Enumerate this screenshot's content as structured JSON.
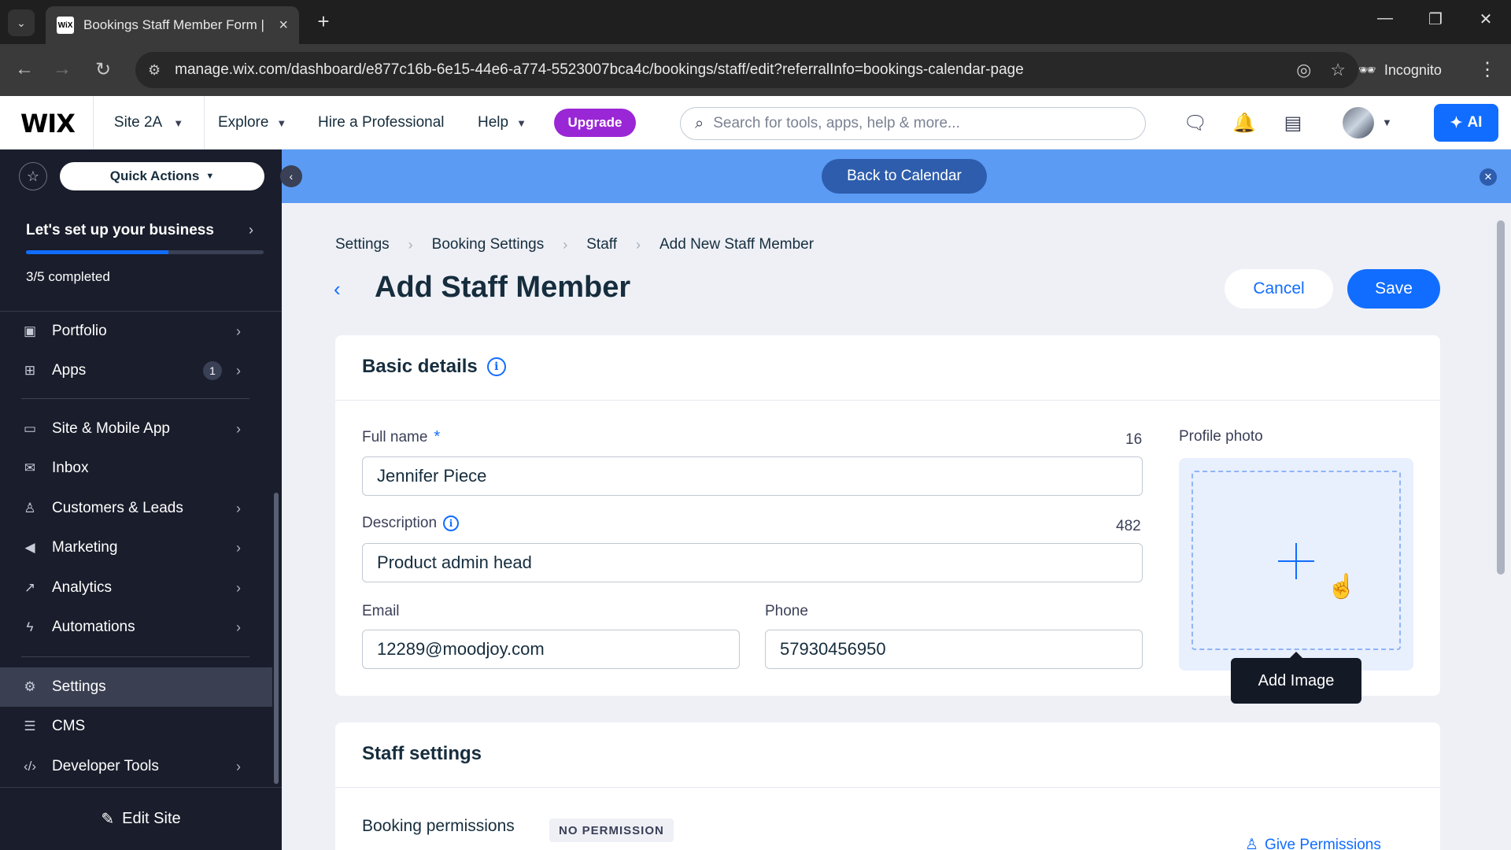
{
  "browser": {
    "tab_title": "Bookings Staff Member Form |",
    "favicon_text": "WiX",
    "url": "manage.wix.com/dashboard/e877c16b-6e15-44e6-a774-5523007bca4c/bookings/staff/edit?referralInfo=bookings-calendar-page",
    "incognito_label": "Incognito"
  },
  "wix_bar": {
    "logo": "WIX",
    "site_name": "Site 2A",
    "nav": [
      {
        "label": "Explore"
      },
      {
        "label": "Hire a Professional"
      },
      {
        "label": "Help"
      }
    ],
    "upgrade_label": "Upgrade",
    "search_placeholder": "Search for tools, apps, help & more...",
    "ai_label": "AI"
  },
  "sidebar": {
    "quick_actions": "Quick Actions",
    "setup_title": "Let's set up your business",
    "setup_progress": 0.6,
    "setup_count": "3/5 completed",
    "items": [
      {
        "label": "Portfolio",
        "icon": "portfolio-icon"
      },
      {
        "label": "Apps",
        "icon": "apps-icon",
        "badge": "1"
      },
      {
        "label": "Site & Mobile App",
        "icon": "site-mobile-icon"
      },
      {
        "label": "Inbox",
        "icon": "inbox-icon"
      },
      {
        "label": "Customers & Leads",
        "icon": "customers-icon"
      },
      {
        "label": "Marketing",
        "icon": "marketing-icon"
      },
      {
        "label": "Analytics",
        "icon": "analytics-icon"
      },
      {
        "label": "Automations",
        "icon": "automations-icon"
      },
      {
        "label": "Settings",
        "icon": "gear-icon"
      },
      {
        "label": "CMS",
        "icon": "cms-icon"
      },
      {
        "label": "Developer Tools",
        "icon": "code-icon"
      }
    ],
    "edit_site": "Edit Site"
  },
  "banner": {
    "back_to_calendar": "Back to Calendar"
  },
  "main": {
    "breadcrumb": [
      "Settings",
      "Booking Settings",
      "Staff",
      "Add New Staff Member"
    ],
    "title": "Add Staff Member",
    "cancel_label": "Cancel",
    "save_label": "Save",
    "basic_details": {
      "title": "Basic details",
      "full_name_label": "Full name",
      "full_name_required": "*",
      "full_name_counter": "16",
      "full_name_value": "Jennifer Piece",
      "description_label": "Description",
      "description_counter": "482",
      "description_value": "Product admin head",
      "email_label": "Email",
      "email_value": "12289@moodjoy.com",
      "phone_label": "Phone",
      "phone_value": "57930456950",
      "profile_photo_label": "Profile photo",
      "add_image_tooltip": "Add Image"
    },
    "staff_settings": {
      "title": "Staff settings",
      "booking_permissions_label": "Booking permissions",
      "permission_badge": "NO PERMISSION",
      "give_permissions": "Give Permissions"
    }
  },
  "colors": {
    "accent": "#116dff",
    "upgrade": "#9a27d5",
    "sidebar_bg": "#1a1d2b",
    "banner": "#5b9bf4"
  }
}
